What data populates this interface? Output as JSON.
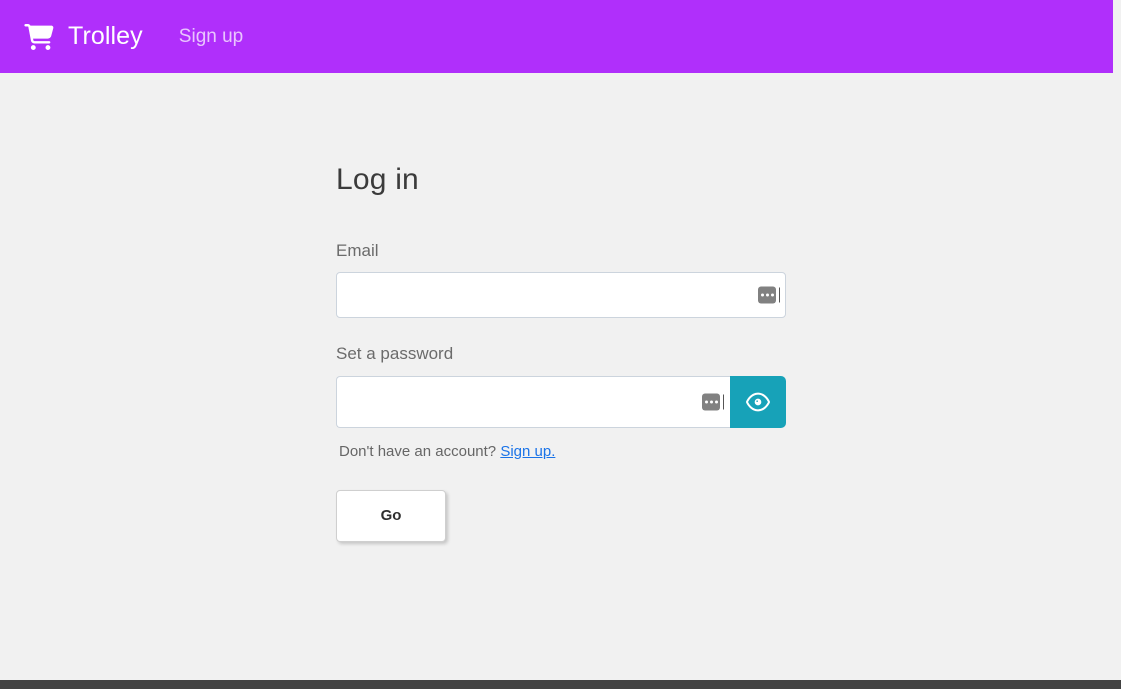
{
  "header": {
    "brand_icon": "shopping-cart-icon",
    "brand_title": "Trolley",
    "nav_signup_label": "Sign up",
    "background_color": "#b02ffb"
  },
  "main": {
    "page_title": "Log in",
    "email_field": {
      "label": "Email",
      "value": "",
      "placeholder": "",
      "autofill_indicator": "autofill-dots-icon"
    },
    "password_field": {
      "label": "Set a password",
      "value": "",
      "placeholder": "",
      "autofill_indicator": "autofill-dots-icon",
      "reveal_button_icon": "eye-icon",
      "reveal_button_color": "#17a2b8"
    },
    "signup_prompt": {
      "text": "Don't have an account?",
      "link_label": "Sign up.",
      "link_color": "#1a73e8"
    },
    "submit_button_label": "Go"
  },
  "footer": {
    "background_color": "#424242"
  },
  "colors": {
    "page_background": "#f1f1f1",
    "accent_purple": "#b02ffb",
    "accent_teal": "#17a2b8",
    "link_blue": "#1a73e8"
  }
}
